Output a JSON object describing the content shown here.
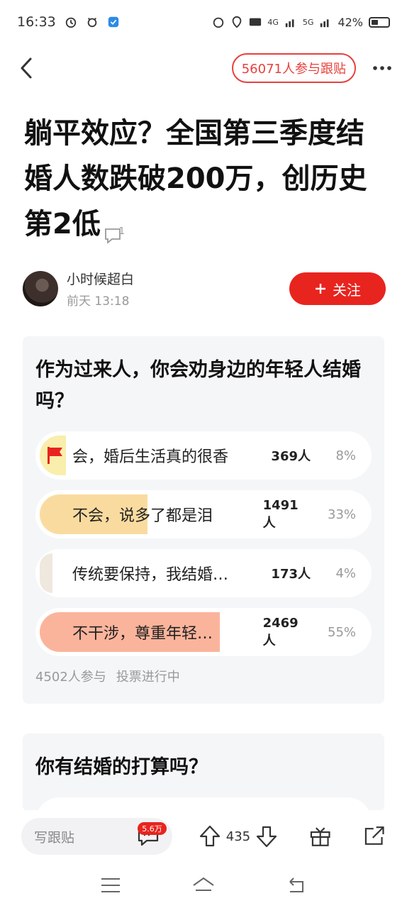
{
  "status_bar": {
    "time": "16:33",
    "network_labels": [
      "4G",
      "5G"
    ],
    "battery": "42%"
  },
  "nav": {
    "participants_label": "56071人参与跟贴"
  },
  "post": {
    "title": "躺平效应？全国第三季度结婚人数跌破200万，创历史第2低",
    "comment_count": "1",
    "author_name": "小时候超白",
    "author_time": "前天 13:18",
    "follow_label": "关注"
  },
  "poll1": {
    "question": "作为过来人，你会劝身边的年轻人结婚吗？",
    "options": [
      {
        "label": "会，婚后生活真的很香",
        "count": "369人",
        "pct": "8%",
        "value": 8,
        "color": "#f9eeab",
        "selected": true
      },
      {
        "label": "不会，说多了都是泪",
        "count": "1491人",
        "pct": "33%",
        "value": 33,
        "color": "#fadb9f",
        "selected": false
      },
      {
        "label": "传统要保持，我结婚…",
        "count": "173人",
        "pct": "4%",
        "value": 4,
        "color": "#efe8df",
        "selected": false
      },
      {
        "label": "不干涉，尊重年轻…",
        "count": "2469人",
        "pct": "55%",
        "value": 55,
        "color": "#fbb49c",
        "selected": false
      }
    ],
    "participants": "4502人参与",
    "status": "投票进行中"
  },
  "poll2": {
    "question": "你有结婚的打算吗？"
  },
  "bottom_bar": {
    "reply_placeholder": "写跟贴",
    "reply_badge": "5.6万",
    "vote_count": "435"
  },
  "colors": {
    "accent": "#e8241f",
    "pill": "#e8403c"
  }
}
